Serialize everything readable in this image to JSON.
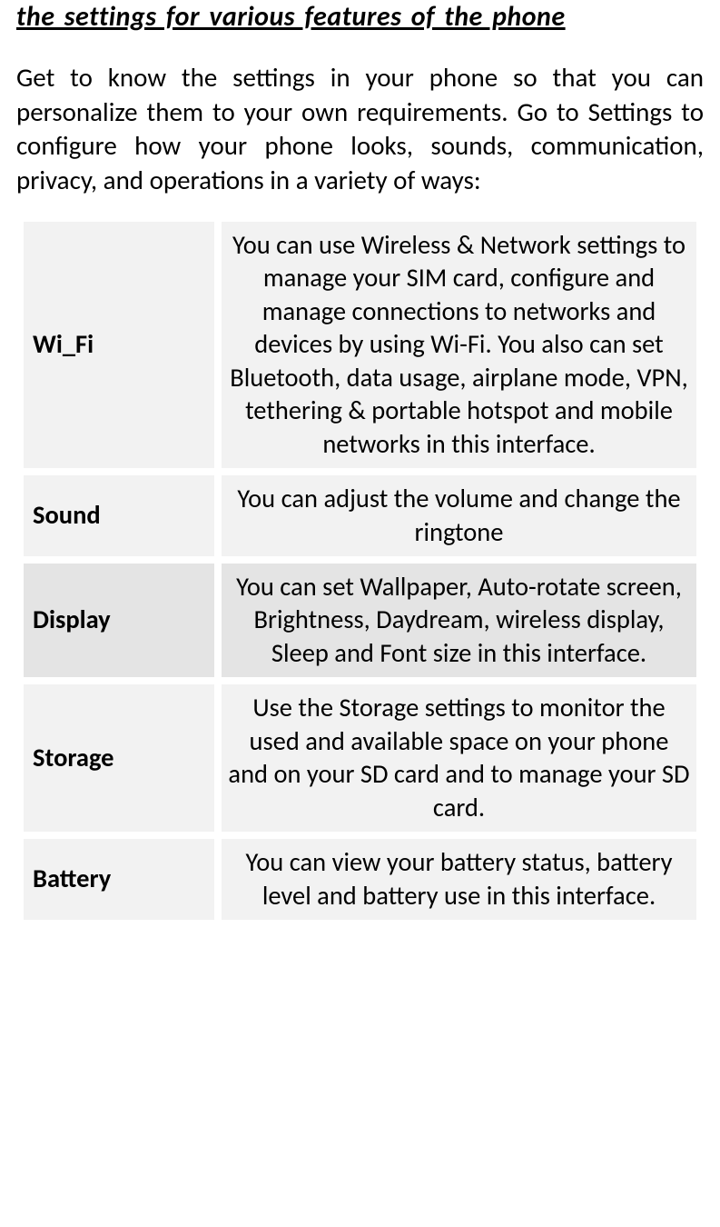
{
  "title": "the settings for various features of the phone",
  "intro": "Get to know the settings in your phone so that you can personalize them to your own requirements. Go to Settings to configure how your phone looks, sounds, communication, privacy, and operations in a variety of ways:",
  "rows": [
    {
      "label": "Wi_Fi",
      "desc": "You can use Wireless & Network settings to manage your SIM card, configure and manage connections to networks and devices by using Wi-Fi. You also can set Bluetooth, data usage, airplane mode, VPN, tethering & portable hotspot and mobile networks in this interface.",
      "alt": false
    },
    {
      "label": "Sound",
      "desc": "You can adjust the volume and change the ringtone",
      "alt": false
    },
    {
      "label": "Display",
      "desc": "You can set Wallpaper, Auto-rotate screen, Brightness, Daydream, wireless display, Sleep and Font size in this interface.",
      "alt": true
    },
    {
      "label": "Storage",
      "desc": "Use the Storage settings to monitor the used and available space on your phone and on your SD card and to manage your SD card.",
      "alt": false
    },
    {
      "label": "Battery",
      "desc": "You can view your battery status, battery level and battery use in this interface.",
      "alt": false
    }
  ]
}
